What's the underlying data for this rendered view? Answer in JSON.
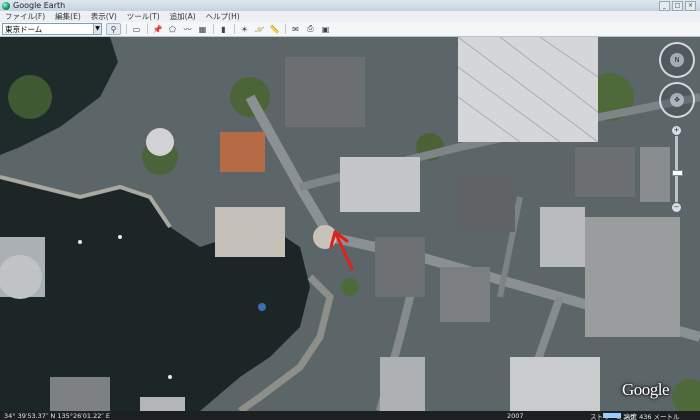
{
  "window": {
    "title": "Google Earth",
    "controls": [
      "_",
      "□",
      "×"
    ]
  },
  "menu": [
    {
      "label": "ファイル(F)"
    },
    {
      "label": "編集(E)"
    },
    {
      "label": "表示(V)"
    },
    {
      "label": "ツール(T)"
    },
    {
      "label": "追加(A)"
    },
    {
      "label": "ヘルプ(H)"
    }
  ],
  "search": {
    "value": "東京ドーム",
    "dropdown_icon": "chevron-down-icon",
    "button_icon": "magnifier-icon"
  },
  "toolbar_icons": [
    "sidebar-toggle-icon",
    "placemark-icon",
    "polygon-icon",
    "path-icon",
    "image-overlay-icon",
    "record-tour-icon",
    "sun-icon",
    "planets-icon",
    "ruler-icon",
    "email-icon",
    "print-icon",
    "maps-icon"
  ],
  "status": {
    "coords": "34° 39′53.37″ N  135°26′01.22″ E",
    "date": "2007",
    "stream_label": "ストリーミング",
    "stream_percent": 100,
    "altitude": "高度  436 メートル"
  },
  "logo": "Google",
  "nav": {
    "look_icon": "look-around-icon",
    "move_icon": "move-arrows-icon",
    "north_label": "N",
    "zoom_in": "+",
    "zoom_out": "−",
    "zoom_level": 0.55
  },
  "colors": {
    "water": "#1f2a2a",
    "roof_light": "#c9cbcc",
    "roof_dark": "#6b6f72",
    "road": "#8b9092",
    "vegetation": "#4f6a3a",
    "accent_red": "#e0201a"
  }
}
